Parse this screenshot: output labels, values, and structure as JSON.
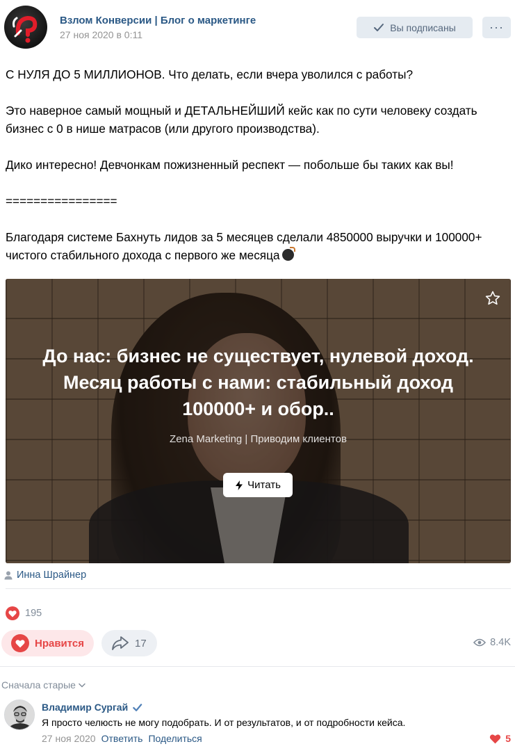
{
  "post": {
    "group_name": "Взлом Конверсии | Блог о маркетинге",
    "date": "27 ноя 2020 в 0:11",
    "subscribe_label": "Вы подписаны",
    "more_label": "···",
    "text": {
      "line1": "С НУЛЯ ДО 5 МИЛЛИОНОВ. Что делать, если вчера уволился с работы?",
      "line2": "Это наверное самый мощный и ДЕТАЛЬНЕЙШИЙ кейс как по сути человеку создать бизнес с 0 в нише матрасов (или другого производства).",
      "line3": "Дико интересно! Девчонкам пожизненный респект — побольше бы таких как вы!",
      "line4": "================",
      "line5": "Благодаря системе Бахнуть лидов за 5 месяцев сделали 4850000 выручки и 100000+ чистого стабильного дохода с первого же месяца"
    },
    "article": {
      "title_line1": "До нас: бизнес не существует, нулевой доход.",
      "title_line2": "Месяц работы с нами: стабильный доход",
      "title_line3": "100000+ и обор..",
      "source": "Zena Marketing | Приводим клиентов",
      "read_label": "Читать"
    },
    "author": "Инна Шрайнер",
    "reactions_count": "195",
    "like_label": "Нравится",
    "share_count": "17",
    "views": "8.4K"
  },
  "comments": {
    "sort_label": "Сначала старые",
    "items": [
      {
        "author": "Владимир Сургай",
        "text": "Я просто челюсть не могу подобрать. И от результатов, и от подробности кейса.",
        "date": "27 ноя 2020",
        "reply_label": "Ответить",
        "share_label": "Поделиться",
        "likes": "5"
      }
    ]
  },
  "colors": {
    "link": "#2a5885",
    "like_red": "#e64646",
    "muted": "#818c99",
    "button_bg": "#e5ebf1"
  }
}
